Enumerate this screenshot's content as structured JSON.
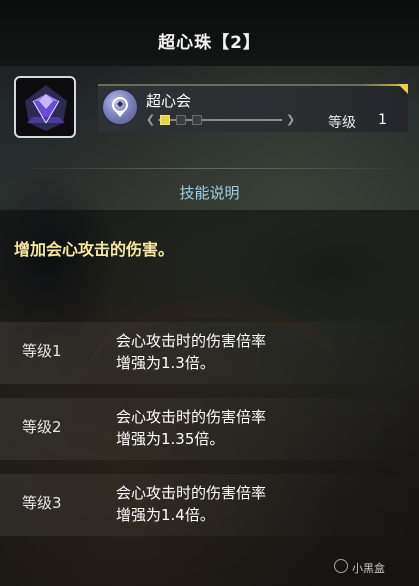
{
  "title": "超心珠【2】",
  "skill": {
    "name": "超心会",
    "level_label": "等级",
    "level_value": "1",
    "level_progress": 1,
    "level_max": 3
  },
  "section_title": "技能说明",
  "description": "增加会心攻击的伤害。",
  "levels": [
    {
      "name": "等级1",
      "effect_line1": "会心攻击时的伤害倍率",
      "effect_line2": "增强为1.3倍。"
    },
    {
      "name": "等级2",
      "effect_line1": "会心攻击时的伤害倍率",
      "effect_line2": "增强为1.35倍。"
    },
    {
      "name": "等级3",
      "effect_line1": "会心攻击时的伤害倍率",
      "effect_line2": "增强为1.4倍。"
    }
  ],
  "watermark": "小黑盒",
  "colors": {
    "accent_gold": "#e7d24d",
    "section_title": "#9ed0e6",
    "description_text": "#f7e9a0",
    "jewel_purple": "#6a4bd6"
  },
  "icons": {
    "jewel": "purple-gem-icon",
    "skill": "critical-boost-skill-icon"
  }
}
